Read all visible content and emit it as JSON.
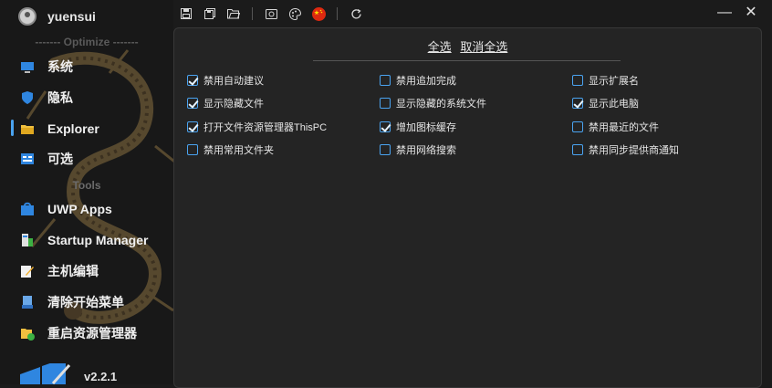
{
  "user": {
    "name": "yuensui"
  },
  "sidebar": {
    "section_optimize": "------- Optimize -------",
    "section_tools": "Tools",
    "items": [
      {
        "label": "系统",
        "icon": "monitor-icon"
      },
      {
        "label": "隐私",
        "icon": "shield-icon"
      },
      {
        "label": "Explorer",
        "icon": "folder-icon"
      },
      {
        "label": "可选",
        "icon": "options-icon"
      },
      {
        "label": "UWP Apps",
        "icon": "store-icon"
      },
      {
        "label": "Startup Manager",
        "icon": "startup-icon"
      },
      {
        "label": "主机编辑",
        "icon": "edit-icon"
      },
      {
        "label": "清除开始菜单",
        "icon": "cleaner-icon"
      },
      {
        "label": "重启资源管理器",
        "icon": "restart-icon"
      }
    ],
    "active_index": 2,
    "version": "v2.2.1"
  },
  "toolbar": [
    "save-icon",
    "save-all-icon",
    "open-folder-icon",
    "screenshot-icon",
    "palette-icon",
    "china-flag-icon",
    "refresh-icon"
  ],
  "window": {
    "minimize": "—",
    "close": "✕"
  },
  "panel": {
    "select_all": "全选",
    "deselect_all": "取消全选",
    "options": [
      {
        "label": "禁用自动建议",
        "checked": true
      },
      {
        "label": "禁用追加完成",
        "checked": false
      },
      {
        "label": "显示扩展名",
        "checked": false
      },
      {
        "label": "显示隐藏文件",
        "checked": true
      },
      {
        "label": "显示隐藏的系统文件",
        "checked": false
      },
      {
        "label": "显示此电脑",
        "checked": true
      },
      {
        "label": "打开文件资源管理器ThisPC",
        "checked": true
      },
      {
        "label": "增加图标缓存",
        "checked": true
      },
      {
        "label": "禁用最近的文件",
        "checked": false
      },
      {
        "label": "禁用常用文件夹",
        "checked": false
      },
      {
        "label": "禁用网络搜索",
        "checked": false
      },
      {
        "label": "禁用同步提供商通知",
        "checked": false
      }
    ]
  },
  "colors": {
    "accent": "#4aa3f0",
    "background": "#1b1b1b",
    "panel": "#242424",
    "dragon": "#8a7040"
  }
}
